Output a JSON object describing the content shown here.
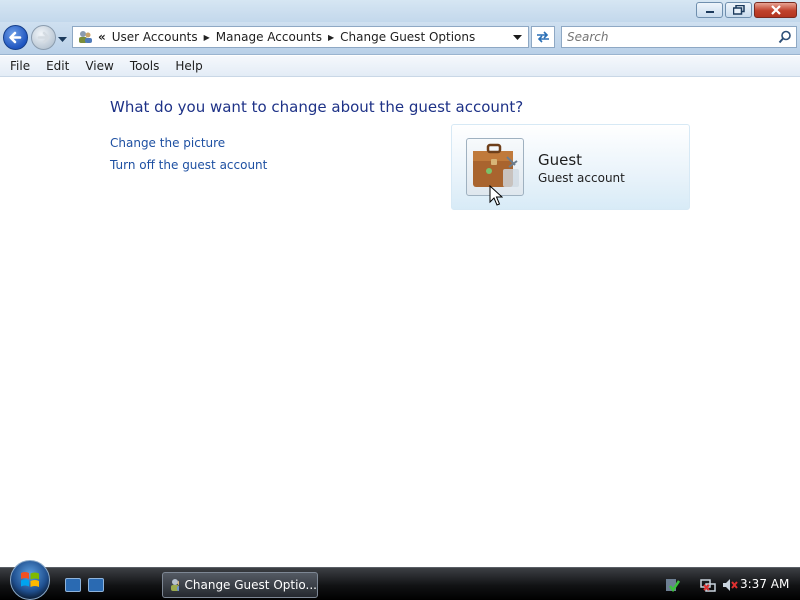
{
  "window": {
    "caption_buttons": {
      "minimize": "minimize-icon",
      "maximize": "restore-icon",
      "close": "close-icon"
    }
  },
  "address": {
    "overflow_glyph": "«",
    "crumbs": [
      "User Accounts",
      "Manage Accounts",
      "Change Guest Options"
    ]
  },
  "search": {
    "placeholder": "Search"
  },
  "menu": {
    "items": [
      "File",
      "Edit",
      "View",
      "Tools",
      "Help"
    ]
  },
  "content": {
    "heading": "What do you want to change about the guest account?",
    "links": [
      "Change the picture",
      "Turn off the guest account"
    ],
    "account": {
      "name": "Guest",
      "type": "Guest account",
      "picture_icon": "briefcase-icon"
    }
  },
  "taskbar": {
    "task_label": "Change Guest Optio...",
    "clock": "3:37 AM"
  },
  "colors": {
    "heading": "#1e3287",
    "link": "#1e50a2",
    "card_accent": "#d8ebf7"
  }
}
